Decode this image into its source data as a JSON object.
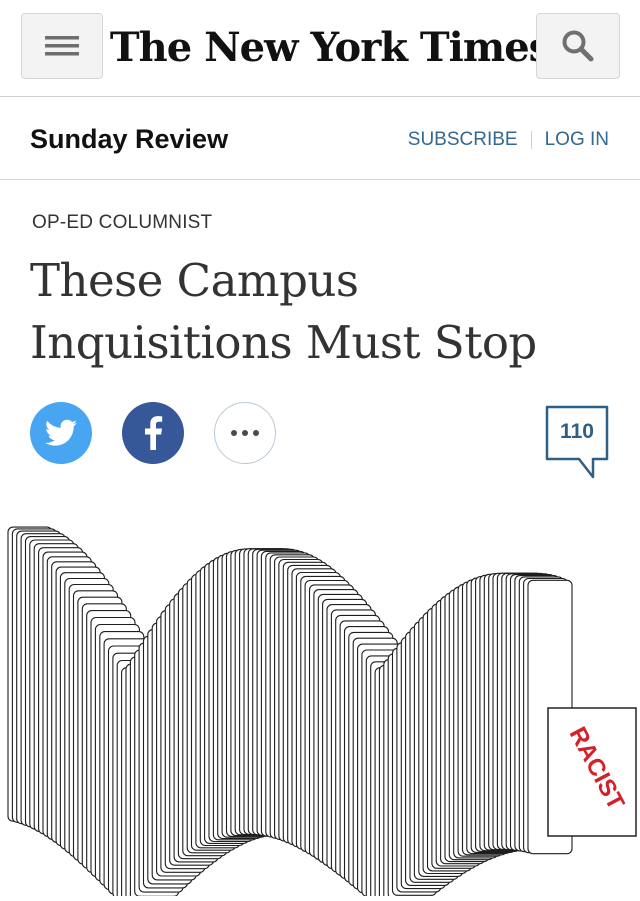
{
  "masthead": {
    "logo_text": "The New York Times",
    "menu_icon": "hamburger-menu-icon",
    "search_icon": "search-icon"
  },
  "section": {
    "name": "Sunday Review",
    "subscribe_label": "SUBSCRIBE",
    "login_label": "LOG IN"
  },
  "article": {
    "kicker": "OP-ED COLUMNIST",
    "headline_line1": "These Campus",
    "headline_line2": "Inquisitions Must Stop",
    "comment_count": "110",
    "illustration_text": "RACIST"
  },
  "share": {
    "twitter_icon": "twitter-icon",
    "facebook_icon": "facebook-icon",
    "more_icon": "more-options-icon"
  },
  "colors": {
    "link_blue": "#326891",
    "twitter_blue": "#47a5f1",
    "facebook_blue": "#365899",
    "stamp_red": "#d61f26"
  }
}
